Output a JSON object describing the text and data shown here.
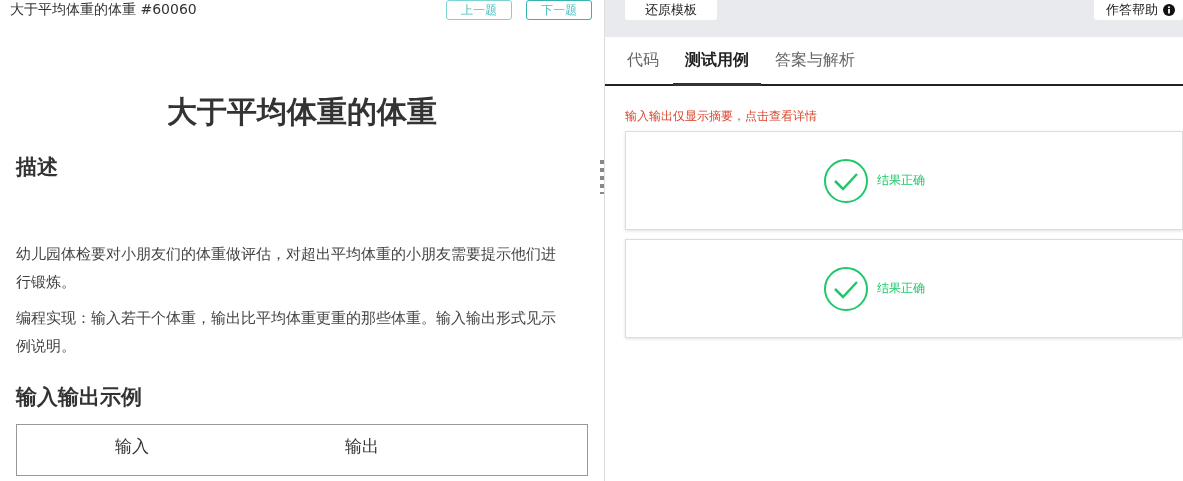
{
  "problem_header": {
    "title": "大于平均体重的体重 #60060",
    "buttons": [
      {
        "label": "上一题",
        "kind": "prev"
      },
      {
        "label": "下一题",
        "kind": "next"
      }
    ]
  },
  "problem": {
    "heading": "大于平均体重的体重",
    "sections": [
      {
        "kind": "text",
        "title": "描述",
        "paragraphs": [
          "幼儿园体检要对小朋友们的体重做评估，对超出平均体重的小朋友需要提示他们进行锻炼。",
          "编程实现：输入若干个体重，输出比平均体重更重的那些体重。输入输出形式见示例说明。"
        ]
      },
      {
        "kind": "table",
        "title": "输入输出示例",
        "columns": [
          "输入",
          "输出"
        ]
      }
    ]
  },
  "toolbar": {
    "left_button": "还原模板",
    "right_button": "作答帮助"
  },
  "tabs": [
    {
      "label": "代码",
      "selected": false
    },
    {
      "label": "测试用例",
      "selected": true
    },
    {
      "label": "答案与解析",
      "selected": false
    }
  ],
  "hint": "输入输出仅显示摘要，点击查看详情",
  "test_cases": [
    {
      "result": "结果正确",
      "passed": true
    },
    {
      "result": "结果正确",
      "passed": true
    }
  ]
}
